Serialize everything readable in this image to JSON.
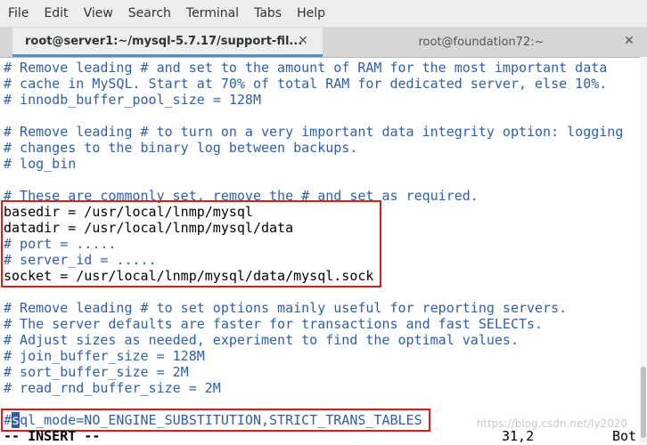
{
  "menubar": {
    "items": [
      "File",
      "Edit",
      "View",
      "Search",
      "Terminal",
      "Tabs",
      "Help"
    ]
  },
  "tabs": [
    {
      "label": "root@server1:~/mysql-5.7.17/support-fil...",
      "active": true
    },
    {
      "label": "root@foundation72:~",
      "active": false
    }
  ],
  "close_glyph": "✕",
  "editor": {
    "lines": [
      {
        "text": "# Remove leading # and set to the amount of RAM for the most important data",
        "kind": "comment"
      },
      {
        "text": "# cache in MySQL. Start at 70% of total RAM for dedicated server, else 10%.",
        "kind": "comment"
      },
      {
        "text": "# innodb_buffer_pool_size = 128M",
        "kind": "comment"
      },
      {
        "text": "",
        "kind": "blank"
      },
      {
        "text": "# Remove leading # to turn on a very important data integrity option: logging",
        "kind": "comment"
      },
      {
        "text": "# changes to the binary log between backups.",
        "kind": "comment"
      },
      {
        "text": "# log_bin",
        "kind": "comment"
      },
      {
        "text": "",
        "kind": "blank"
      },
      {
        "text": "# These are commonly set, remove the # and set as required.",
        "kind": "comment"
      },
      {
        "text": "basedir = /usr/local/lnmp/mysql",
        "kind": "code"
      },
      {
        "text": "datadir = /usr/local/lnmp/mysql/data",
        "kind": "code"
      },
      {
        "text": "# port = .....",
        "kind": "comment"
      },
      {
        "text": "# server_id = .....",
        "kind": "comment"
      },
      {
        "text": "socket = /usr/local/lnmp/mysql/data/mysql.sock",
        "kind": "code"
      },
      {
        "text": "",
        "kind": "blank"
      },
      {
        "text": "# Remove leading # to set options mainly useful for reporting servers.",
        "kind": "comment"
      },
      {
        "text": "# The server defaults are faster for transactions and fast SELECTs.",
        "kind": "comment"
      },
      {
        "text": "# Adjust sizes as needed, experiment to find the optimal values.",
        "kind": "comment"
      },
      {
        "text": "# join_buffer_size = 128M",
        "kind": "comment"
      },
      {
        "text": "# sort_buffer_size = 2M",
        "kind": "comment"
      },
      {
        "text": "# read_rnd_buffer_size = 2M",
        "kind": "comment"
      },
      {
        "text": "",
        "kind": "blank"
      },
      {
        "text": "#sql_mode=NO_ENGINE_SUBSTITUTION,STRICT_TRANS_TABLES",
        "kind": "comment",
        "cursor_char": 1
      }
    ]
  },
  "statusline": {
    "mode": "-- INSERT --",
    "position": "31,2",
    "scroll": "Bot"
  },
  "watermark": "https://blog.csdn.net/ly2020",
  "colors": {
    "comment": "#2f5fa8",
    "highlight_box": "#e01b1b",
    "tab_accent": "#4a90d9"
  }
}
